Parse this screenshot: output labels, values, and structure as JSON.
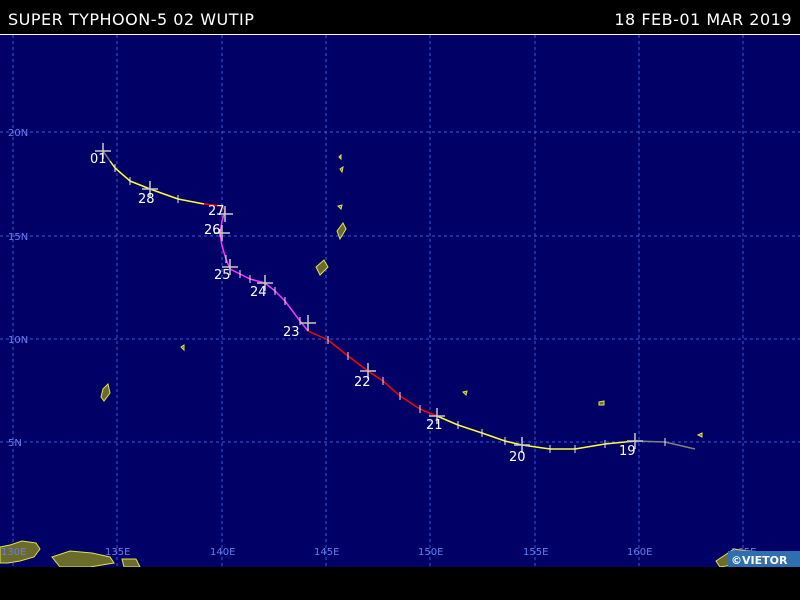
{
  "header": {
    "title": "SUPER TYPHOON-5 02 WUTIP",
    "dates": "18 FEB-01 MAR 2019"
  },
  "map": {
    "lat_labels": [
      "20N",
      "15N",
      "10N",
      "5N"
    ],
    "lon_labels": [
      "130E",
      "135E",
      "140E",
      "145E",
      "150E",
      "155E",
      "160E",
      "165E"
    ],
    "day_labels": [
      "19",
      "20",
      "21",
      "22",
      "23",
      "24",
      "25",
      "26",
      "27",
      "28",
      "01"
    ],
    "credit": "©VIETOR",
    "colors": {
      "ocean": "#000066",
      "grid": "#3a5bd9",
      "land_fill": "#6b6b2a",
      "land_outline": "#e3e34a",
      "depression": "#808080",
      "storm": "#ffff33",
      "typhoon": "#ff0000",
      "super_typhoon": "#ff33ff",
      "marker": "#c8c8c8"
    }
  }
}
